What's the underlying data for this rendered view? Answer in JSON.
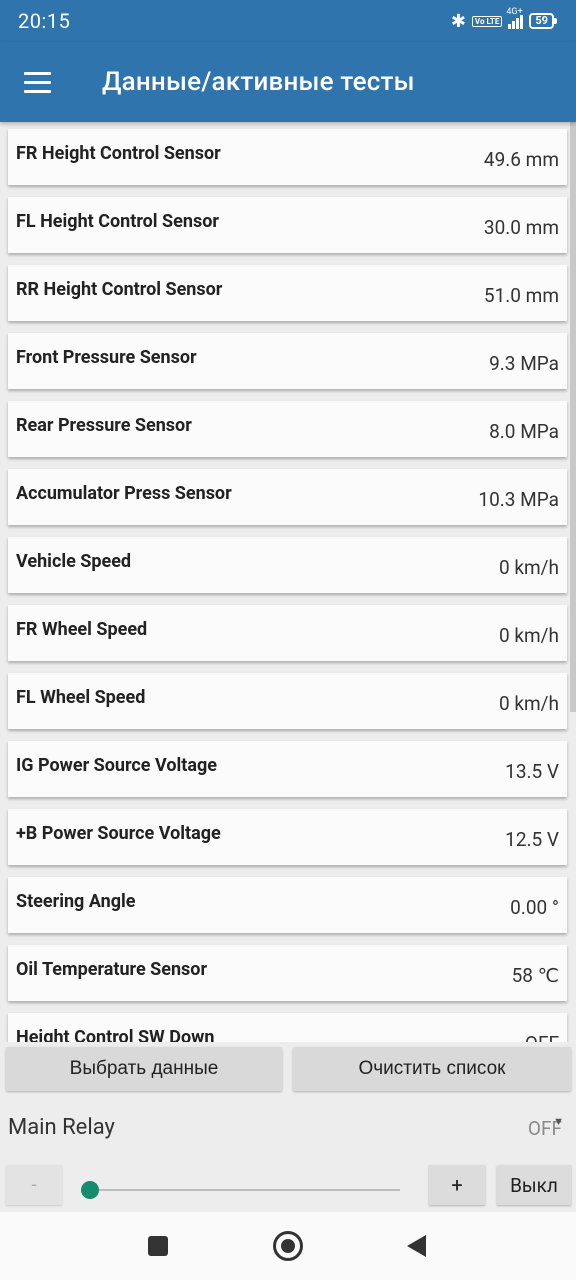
{
  "status_bar": {
    "time": "20:15",
    "network": "4G+",
    "volte": "Vo LTE",
    "battery": "59"
  },
  "app_bar": {
    "title": "Данные/активные тесты"
  },
  "data_list": [
    {
      "name": "FR Height Control Sensor",
      "value": "49.6 mm"
    },
    {
      "name": "FL Height Control Sensor",
      "value": "30.0 mm"
    },
    {
      "name": "RR Height Control Sensor",
      "value": "51.0 mm"
    },
    {
      "name": "Front Pressure Sensor",
      "value": "9.3 MPa"
    },
    {
      "name": "Rear Pressure Sensor",
      "value": "8.0 MPa"
    },
    {
      "name": "Accumulator Press Sensor",
      "value": "10.3 MPa"
    },
    {
      "name": "Vehicle Speed",
      "value": "0 km/h"
    },
    {
      "name": "FR Wheel Speed",
      "value": "0 km/h"
    },
    {
      "name": "FL Wheel Speed",
      "value": "0 km/h"
    },
    {
      "name": "IG Power Source Voltage",
      "value": "13.5 V"
    },
    {
      "name": "+B Power Source Voltage",
      "value": "12.5 V"
    },
    {
      "name": "Steering Angle",
      "value": "0.00 °"
    },
    {
      "name": "Oil Temperature Sensor",
      "value": "58 ℃"
    },
    {
      "name": "Height Control SW Down",
      "value": "OFF"
    }
  ],
  "buttons": {
    "select_data": "Выбрать данные",
    "clear_list": "Очистить список"
  },
  "active_test": {
    "label": "Main Relay",
    "selected_value": "OFF",
    "minus": "-",
    "plus": "+",
    "off": "Выкл",
    "slider_value": 0
  },
  "colors": {
    "primary": "#2f74ad",
    "accent": "#168c6e"
  }
}
